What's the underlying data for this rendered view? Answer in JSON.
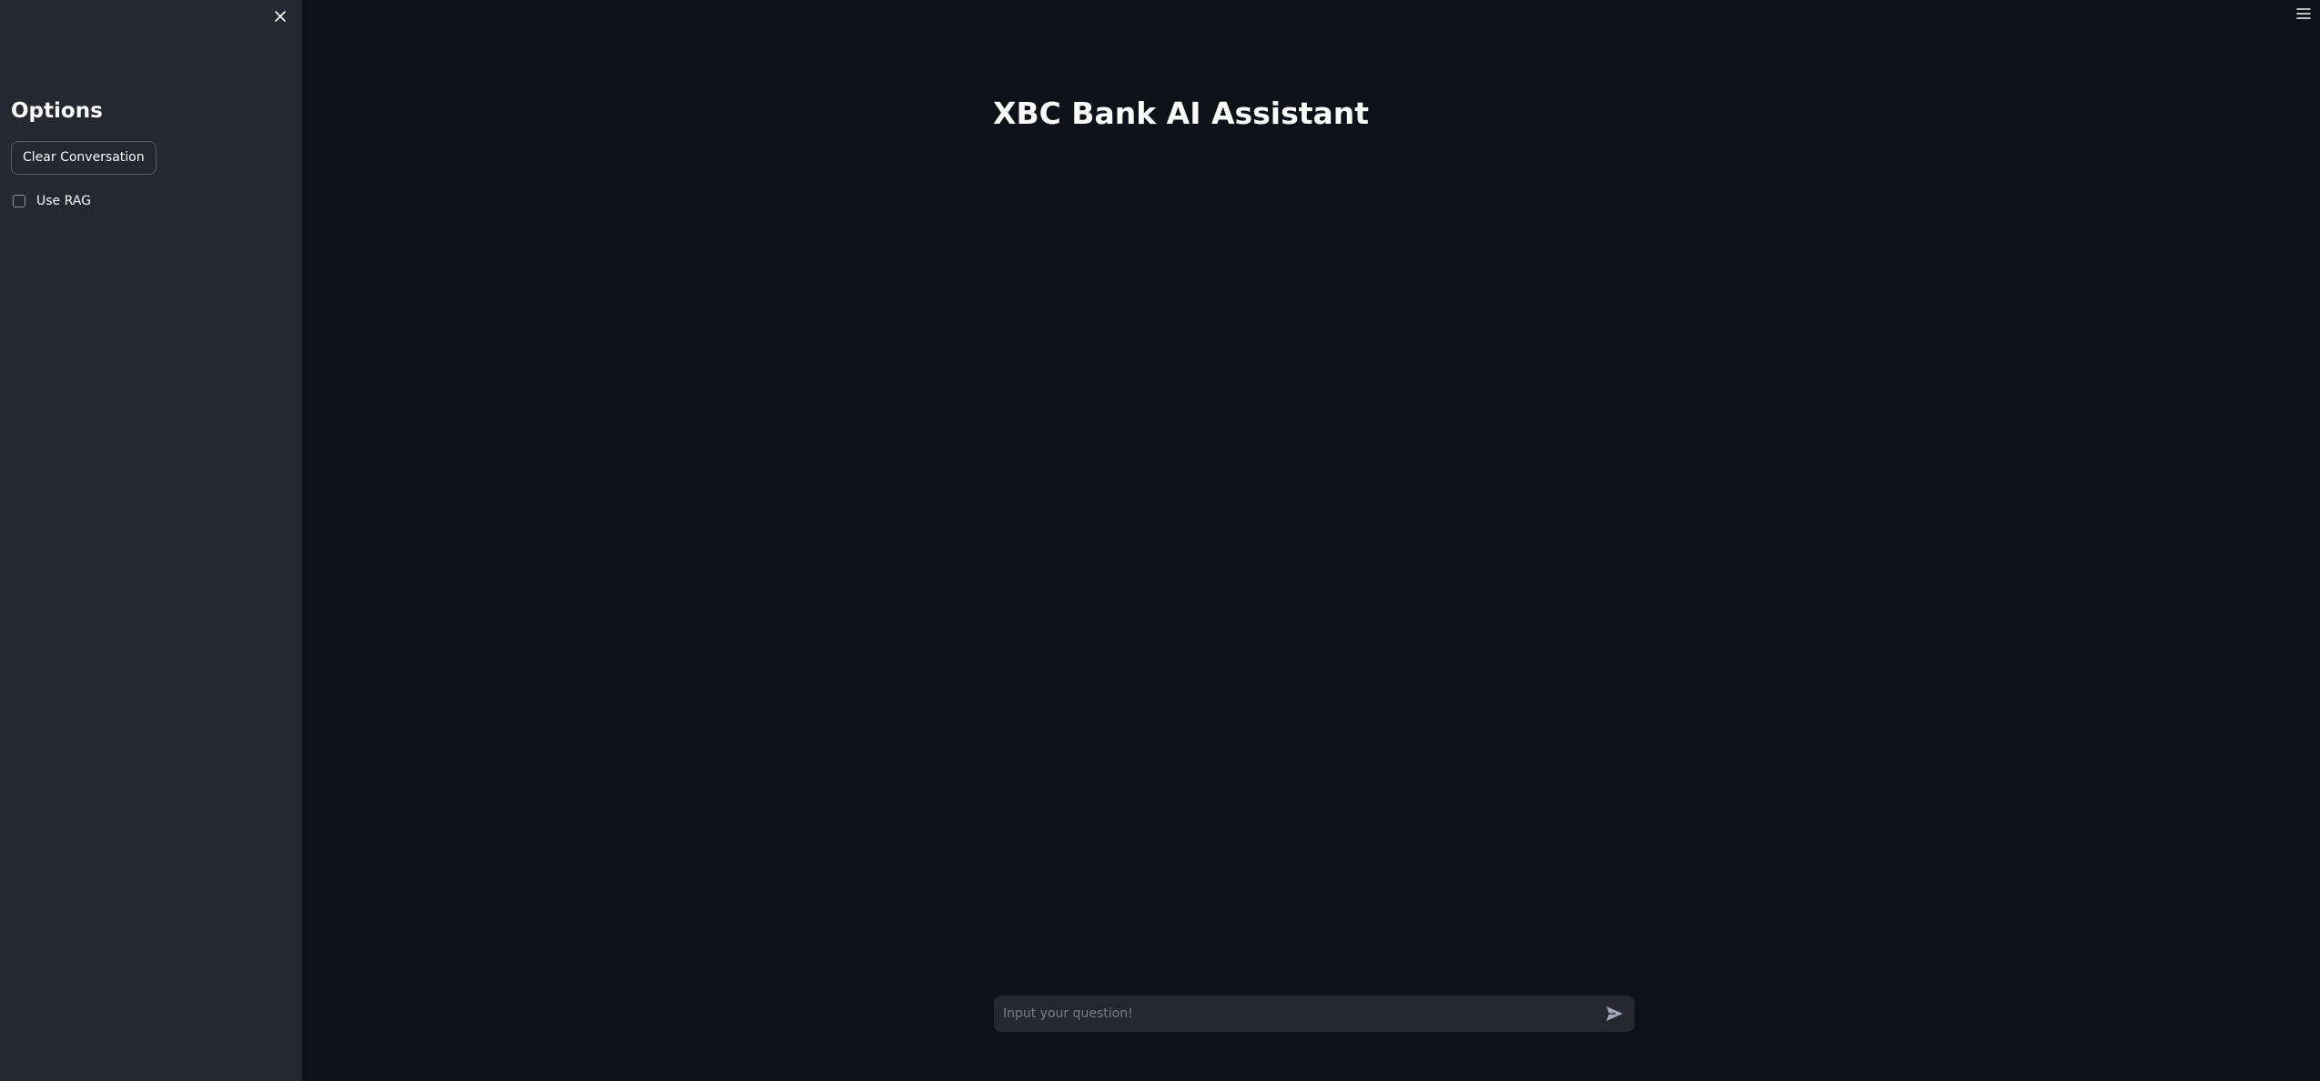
{
  "sidebar": {
    "title": "Options",
    "clear_button_label": "Clear Conversation",
    "rag_checkbox_label": "Use RAG",
    "rag_checked": false,
    "close_icon": "close-icon"
  },
  "header": {
    "menu_icon": "hamburger-menu-icon"
  },
  "main": {
    "title": "XBC Bank AI Assistant"
  },
  "chat": {
    "placeholder": "Input your question!",
    "value": "",
    "send_icon": "send-icon"
  },
  "colors": {
    "background": "#0e1117",
    "sidebar_background": "#262730",
    "text": "#fafafa",
    "input_background": "#262730"
  }
}
